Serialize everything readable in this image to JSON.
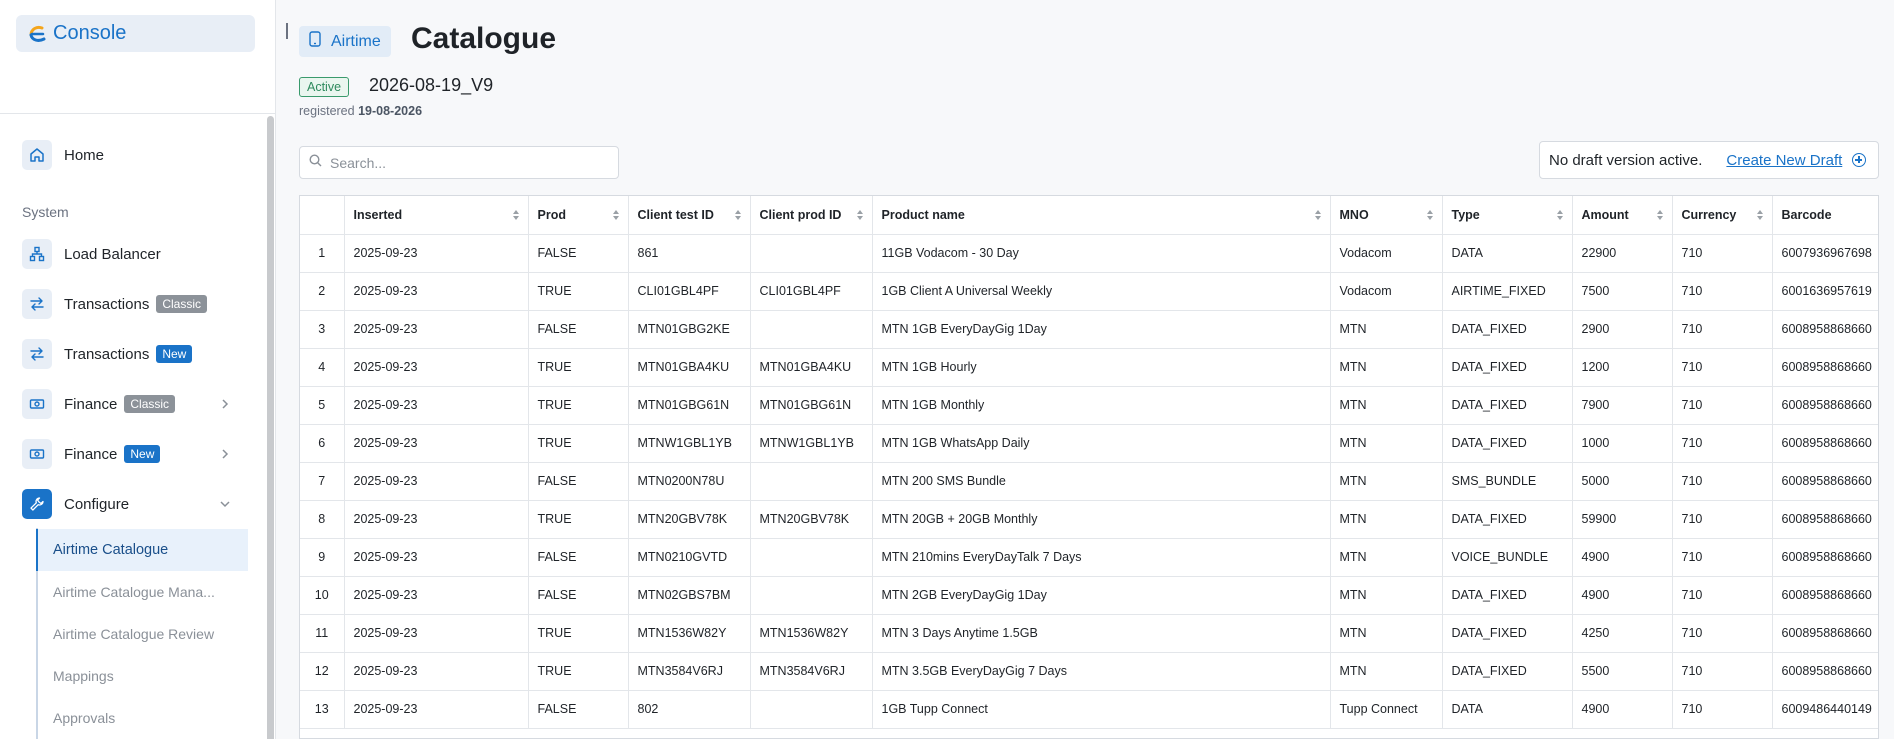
{
  "app": {
    "logo_text": "Console"
  },
  "sidebar": {
    "home": "Home",
    "section_system": "System",
    "load_balancer": "Load Balancer",
    "transactions_classic": {
      "label": "Transactions",
      "badge": "Classic"
    },
    "transactions_new": {
      "label": "Transactions",
      "badge": "New"
    },
    "finance_classic": {
      "label": "Finance",
      "badge": "Classic"
    },
    "finance_new": {
      "label": "Finance",
      "badge": "New"
    },
    "configure": "Configure",
    "sub_items": [
      "Airtime Catalogue",
      "Airtime Catalogue Mana...",
      "Airtime Catalogue Review",
      "Mappings",
      "Approvals"
    ]
  },
  "header": {
    "chip_label": "Airtime",
    "title": "Catalogue",
    "status": "Active",
    "version": "2026-08-19_V9",
    "registered_prefix": "registered",
    "registered_date": "19-08-2026"
  },
  "search": {
    "placeholder": "Search..."
  },
  "draft": {
    "text": "No draft version active.",
    "link": "Create New Draft"
  },
  "table": {
    "columns": [
      "",
      "Inserted",
      "Prod",
      "Client test ID",
      "Client prod ID",
      "Product name",
      "MNO",
      "Type",
      "Amount",
      "Currency",
      "Barcode"
    ],
    "rows": [
      [
        "1",
        "2025-09-23",
        "FALSE",
        "861",
        "",
        "11GB Vodacom - 30 Day",
        "Vodacom",
        "DATA",
        "22900",
        "710",
        "6007936967698"
      ],
      [
        "2",
        "2025-09-23",
        "TRUE",
        "CLI01GBL4PF",
        "CLI01GBL4PF",
        "1GB Client A Universal Weekly",
        "Vodacom",
        "AIRTIME_FIXED",
        "7500",
        "710",
        "6001636957619"
      ],
      [
        "3",
        "2025-09-23",
        "FALSE",
        "MTN01GBG2KE",
        "",
        "MTN 1GB EveryDayGig 1Day",
        "MTN",
        "DATA_FIXED",
        "2900",
        "710",
        "6008958868660"
      ],
      [
        "4",
        "2025-09-23",
        "TRUE",
        "MTN01GBA4KU",
        "MTN01GBA4KU",
        "MTN 1GB Hourly",
        "MTN",
        "DATA_FIXED",
        "1200",
        "710",
        "6008958868660"
      ],
      [
        "5",
        "2025-09-23",
        "TRUE",
        "MTN01GBG61N",
        "MTN01GBG61N",
        "MTN 1GB Monthly",
        "MTN",
        "DATA_FIXED",
        "7900",
        "710",
        "6008958868660"
      ],
      [
        "6",
        "2025-09-23",
        "TRUE",
        "MTNW1GBL1YB",
        "MTNW1GBL1YB",
        "MTN 1GB WhatsApp Daily",
        "MTN",
        "DATA_FIXED",
        "1000",
        "710",
        "6008958868660"
      ],
      [
        "7",
        "2025-09-23",
        "FALSE",
        "MTN0200N78U",
        "",
        "MTN 200 SMS Bundle",
        "MTN",
        "SMS_BUNDLE",
        "5000",
        "710",
        "6008958868660"
      ],
      [
        "8",
        "2025-09-23",
        "TRUE",
        "MTN20GBV78K",
        "MTN20GBV78K",
        "MTN 20GB + 20GB Monthly",
        "MTN",
        "DATA_FIXED",
        "59900",
        "710",
        "6008958868660"
      ],
      [
        "9",
        "2025-09-23",
        "FALSE",
        "MTN0210GVTD",
        "",
        "MTN 210mins EveryDayTalk 7 Days",
        "MTN",
        "VOICE_BUNDLE",
        "4900",
        "710",
        "6008958868660"
      ],
      [
        "10",
        "2025-09-23",
        "FALSE",
        "MTN02GBS7BM",
        "",
        "MTN 2GB EveryDayGig 1Day",
        "MTN",
        "DATA_FIXED",
        "4900",
        "710",
        "6008958868660"
      ],
      [
        "11",
        "2025-09-23",
        "TRUE",
        "MTN1536W82Y",
        "MTN1536W82Y",
        "MTN 3 Days Anytime 1.5GB",
        "MTN",
        "DATA_FIXED",
        "4250",
        "710",
        "6008958868660"
      ],
      [
        "12",
        "2025-09-23",
        "TRUE",
        "MTN3584V6RJ",
        "MTN3584V6RJ",
        "MTN 3.5GB EveryDayGig 7 Days",
        "MTN",
        "DATA_FIXED",
        "5500",
        "710",
        "6008958868660"
      ],
      [
        "13",
        "2025-09-23",
        "FALSE",
        "802",
        "",
        "1GB Tupp Connect",
        "Tupp Connect",
        "DATA",
        "4900",
        "710",
        "6009486440149"
      ]
    ]
  },
  "colors": {
    "accent": "#1a73c8",
    "active_green": "#2e8a5d"
  }
}
